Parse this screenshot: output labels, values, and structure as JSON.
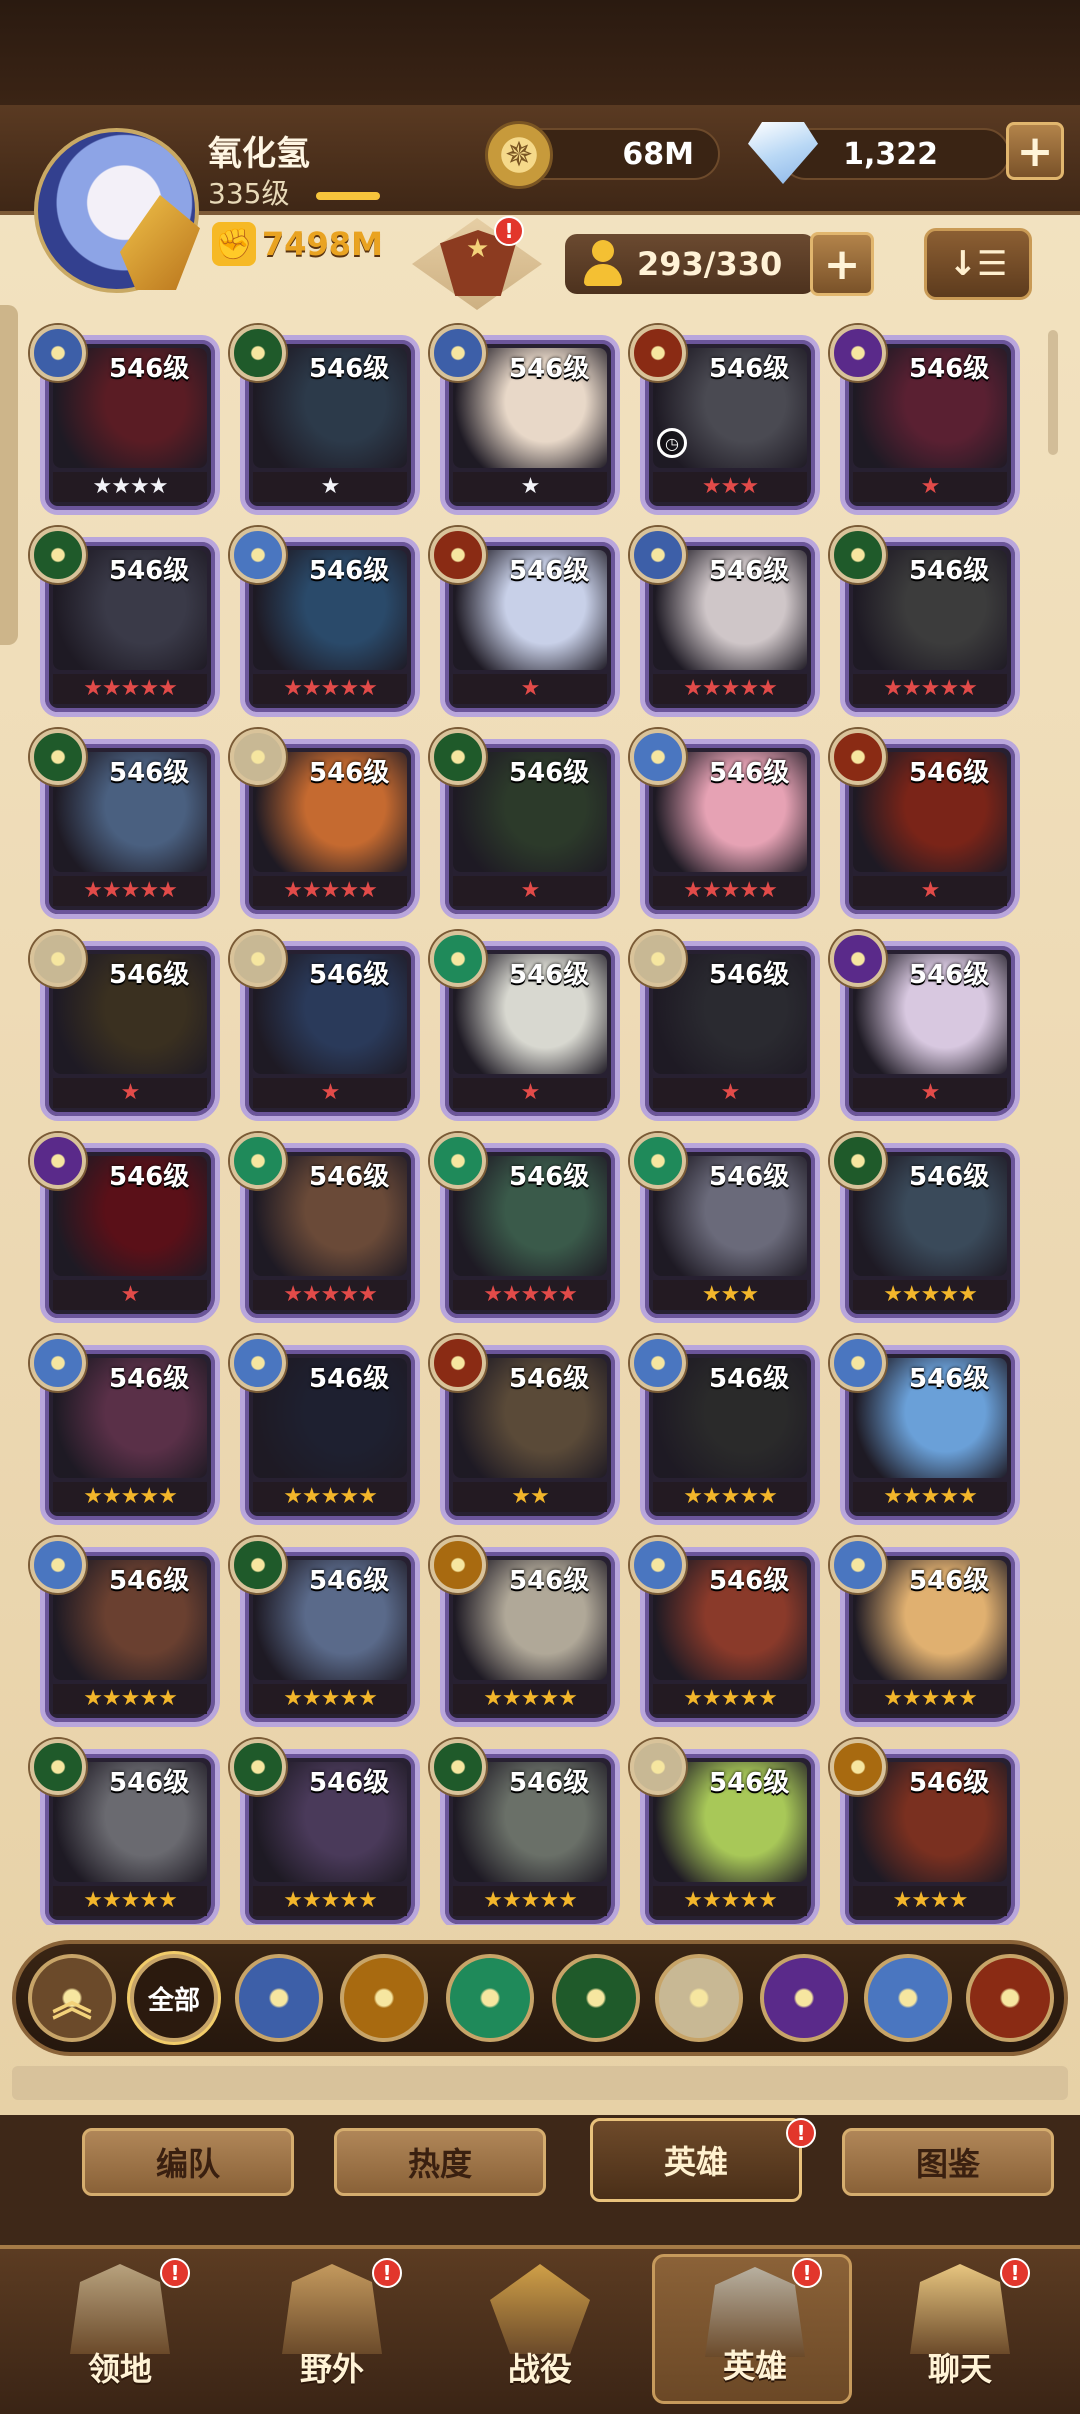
{
  "player": {
    "name": "氧化氢",
    "level": "335级",
    "power": "7498M",
    "xp_fraction": 1.0
  },
  "currency": {
    "gold": "68M",
    "diamonds": "1,322"
  },
  "roster": {
    "count": "293/330"
  },
  "badges": {
    "notification": "!"
  },
  "level_label": "546级",
  "heroes": [
    {
      "faction": "celestial",
      "stars": 4,
      "star_color": "white",
      "hue": "#5a1c24"
    },
    {
      "faction": "wilder",
      "stars": 1,
      "star_color": "white",
      "hue": "#2c3a4a"
    },
    {
      "faction": "celestial",
      "stars": 1,
      "star_color": "white",
      "hue": "#e8d8c8"
    },
    {
      "faction": "graveborn",
      "stars": 3,
      "star_color": "red",
      "hue": "#4a4a52",
      "timer": true
    },
    {
      "faction": "hypogean",
      "stars": 1,
      "star_color": "red",
      "hue": "#5a2032"
    },
    {
      "faction": "wilder",
      "stars": 5,
      "star_color": "red",
      "hue": "#3a3a48"
    },
    {
      "faction": "lightbearer",
      "stars": 5,
      "star_color": "red",
      "hue": "#2a4a6a"
    },
    {
      "faction": "graveborn",
      "stars": 1,
      "star_color": "red",
      "hue": "#c8d0e8"
    },
    {
      "faction": "celestial",
      "stars": 5,
      "star_color": "red",
      "hue": "#cfc6c8"
    },
    {
      "faction": "wilder",
      "stars": 5,
      "star_color": "red",
      "hue": "#3c3c3c"
    },
    {
      "faction": "wilder",
      "stars": 5,
      "star_color": "red",
      "hue": "#4a6080"
    },
    {
      "faction": "dimensional",
      "stars": 5,
      "star_color": "red",
      "hue": "#c56a30"
    },
    {
      "faction": "wilder",
      "stars": 1,
      "star_color": "red",
      "hue": "#2c3a2a"
    },
    {
      "faction": "lightbearer",
      "stars": 5,
      "star_color": "red",
      "hue": "#e6a2b4"
    },
    {
      "faction": "graveborn",
      "stars": 1,
      "star_color": "red",
      "hue": "#7a2418"
    },
    {
      "faction": "dimensional",
      "stars": 1,
      "star_color": "red",
      "hue": "#3a3020"
    },
    {
      "faction": "dimensional",
      "stars": 1,
      "star_color": "red",
      "hue": "#2a3a5a"
    },
    {
      "faction": "mauler",
      "stars": 1,
      "star_color": "red",
      "hue": "#d8d8d0"
    },
    {
      "faction": "dimensional",
      "stars": 1,
      "star_color": "red",
      "hue": "#2a2a30"
    },
    {
      "faction": "hypogean",
      "stars": 1,
      "star_color": "red",
      "hue": "#d8c8e0"
    },
    {
      "faction": "hypogean",
      "stars": 1,
      "star_color": "red",
      "hue": "#5a1018"
    },
    {
      "faction": "mauler",
      "stars": 5,
      "star_color": "red",
      "hue": "#6a4a38"
    },
    {
      "faction": "mauler",
      "stars": 5,
      "star_color": "red",
      "hue": "#3a5a4a"
    },
    {
      "faction": "mauler",
      "stars": 3,
      "star_color": "gold",
      "hue": "#6a6a7a"
    },
    {
      "faction": "wilder",
      "stars": 5,
      "star_color": "gold",
      "hue": "#3a4a5a"
    },
    {
      "faction": "lightbearer",
      "stars": 5,
      "star_color": "gold",
      "hue": "#5a3048"
    },
    {
      "faction": "lightbearer",
      "stars": 5,
      "star_color": "gold",
      "hue": "#1e2030"
    },
    {
      "faction": "graveborn",
      "stars": 2,
      "star_color": "gold",
      "hue": "#5a4a38"
    },
    {
      "faction": "lightbearer",
      "stars": 5,
      "star_color": "gold",
      "hue": "#2a2a2a"
    },
    {
      "faction": "lightbearer",
      "stars": 5,
      "star_color": "gold",
      "hue": "#6aa0d8"
    },
    {
      "faction": "lightbearer",
      "stars": 5,
      "star_color": "gold",
      "hue": "#6a4030"
    },
    {
      "faction": "wilder",
      "stars": 5,
      "star_color": "gold",
      "hue": "#5a6a8a"
    },
    {
      "faction": "graveborn-gold",
      "stars": 5,
      "star_color": "gold",
      "hue": "#b0a898"
    },
    {
      "faction": "lightbearer",
      "stars": 5,
      "star_color": "gold",
      "hue": "#8a3a2a"
    },
    {
      "faction": "lightbearer",
      "stars": 5,
      "star_color": "gold",
      "hue": "#e0b070"
    },
    {
      "faction": "wilder",
      "stars": 5,
      "star_color": "gold",
      "hue": "#6a6a70"
    },
    {
      "faction": "wilder",
      "stars": 5,
      "star_color": "gold",
      "hue": "#4a3a5a"
    },
    {
      "faction": "wilder",
      "stars": 5,
      "star_color": "gold",
      "hue": "#6a7068"
    },
    {
      "faction": "dimensional",
      "stars": 5,
      "star_color": "gold",
      "hue": "#a8c858"
    },
    {
      "faction": "graveborn-gold",
      "stars": 4,
      "star_color": "gold",
      "hue": "#7a3020"
    }
  ],
  "faction_filters": [
    {
      "id": "collapse",
      "label": ""
    },
    {
      "id": "all",
      "label": "全部"
    },
    {
      "id": "celestial",
      "label": ""
    },
    {
      "id": "graveborn-gold",
      "label": ""
    },
    {
      "id": "mauler",
      "label": ""
    },
    {
      "id": "wilder",
      "label": ""
    },
    {
      "id": "dimensional",
      "label": ""
    },
    {
      "id": "hypogean",
      "label": ""
    },
    {
      "id": "lightbearer",
      "label": ""
    },
    {
      "id": "graveborn",
      "label": ""
    }
  ],
  "subtabs": [
    {
      "label": "编队",
      "active": false,
      "notify": false
    },
    {
      "label": "热度",
      "active": false,
      "notify": false
    },
    {
      "label": "英雄",
      "active": true,
      "notify": true
    },
    {
      "label": "图鉴",
      "active": false,
      "notify": false
    }
  ],
  "nav": [
    {
      "label": "领地",
      "icon": "castle-icon",
      "notify": true,
      "active": false
    },
    {
      "label": "野外",
      "icon": "map-scroll-icon",
      "notify": true,
      "active": false
    },
    {
      "label": "战役",
      "icon": "sword-wings-icon",
      "notify": false,
      "active": false
    },
    {
      "label": "英雄",
      "icon": "helmet-icon",
      "notify": true,
      "active": true
    },
    {
      "label": "聊天",
      "icon": "chat-bubble-icon",
      "notify": true,
      "active": false
    }
  ],
  "faction_colors": {
    "celestial": "#3d5fa8",
    "wilder": "#1f5a2a",
    "graveborn": "#8a2b14",
    "graveborn-gold": "#a86a10",
    "hypogean": "#5a2a8a",
    "lightbearer": "#4a76c0",
    "mauler": "#1f8a5a",
    "dimensional": "#c8b894",
    "collapse": "#6b4a2a",
    "all": "#3a2414"
  }
}
